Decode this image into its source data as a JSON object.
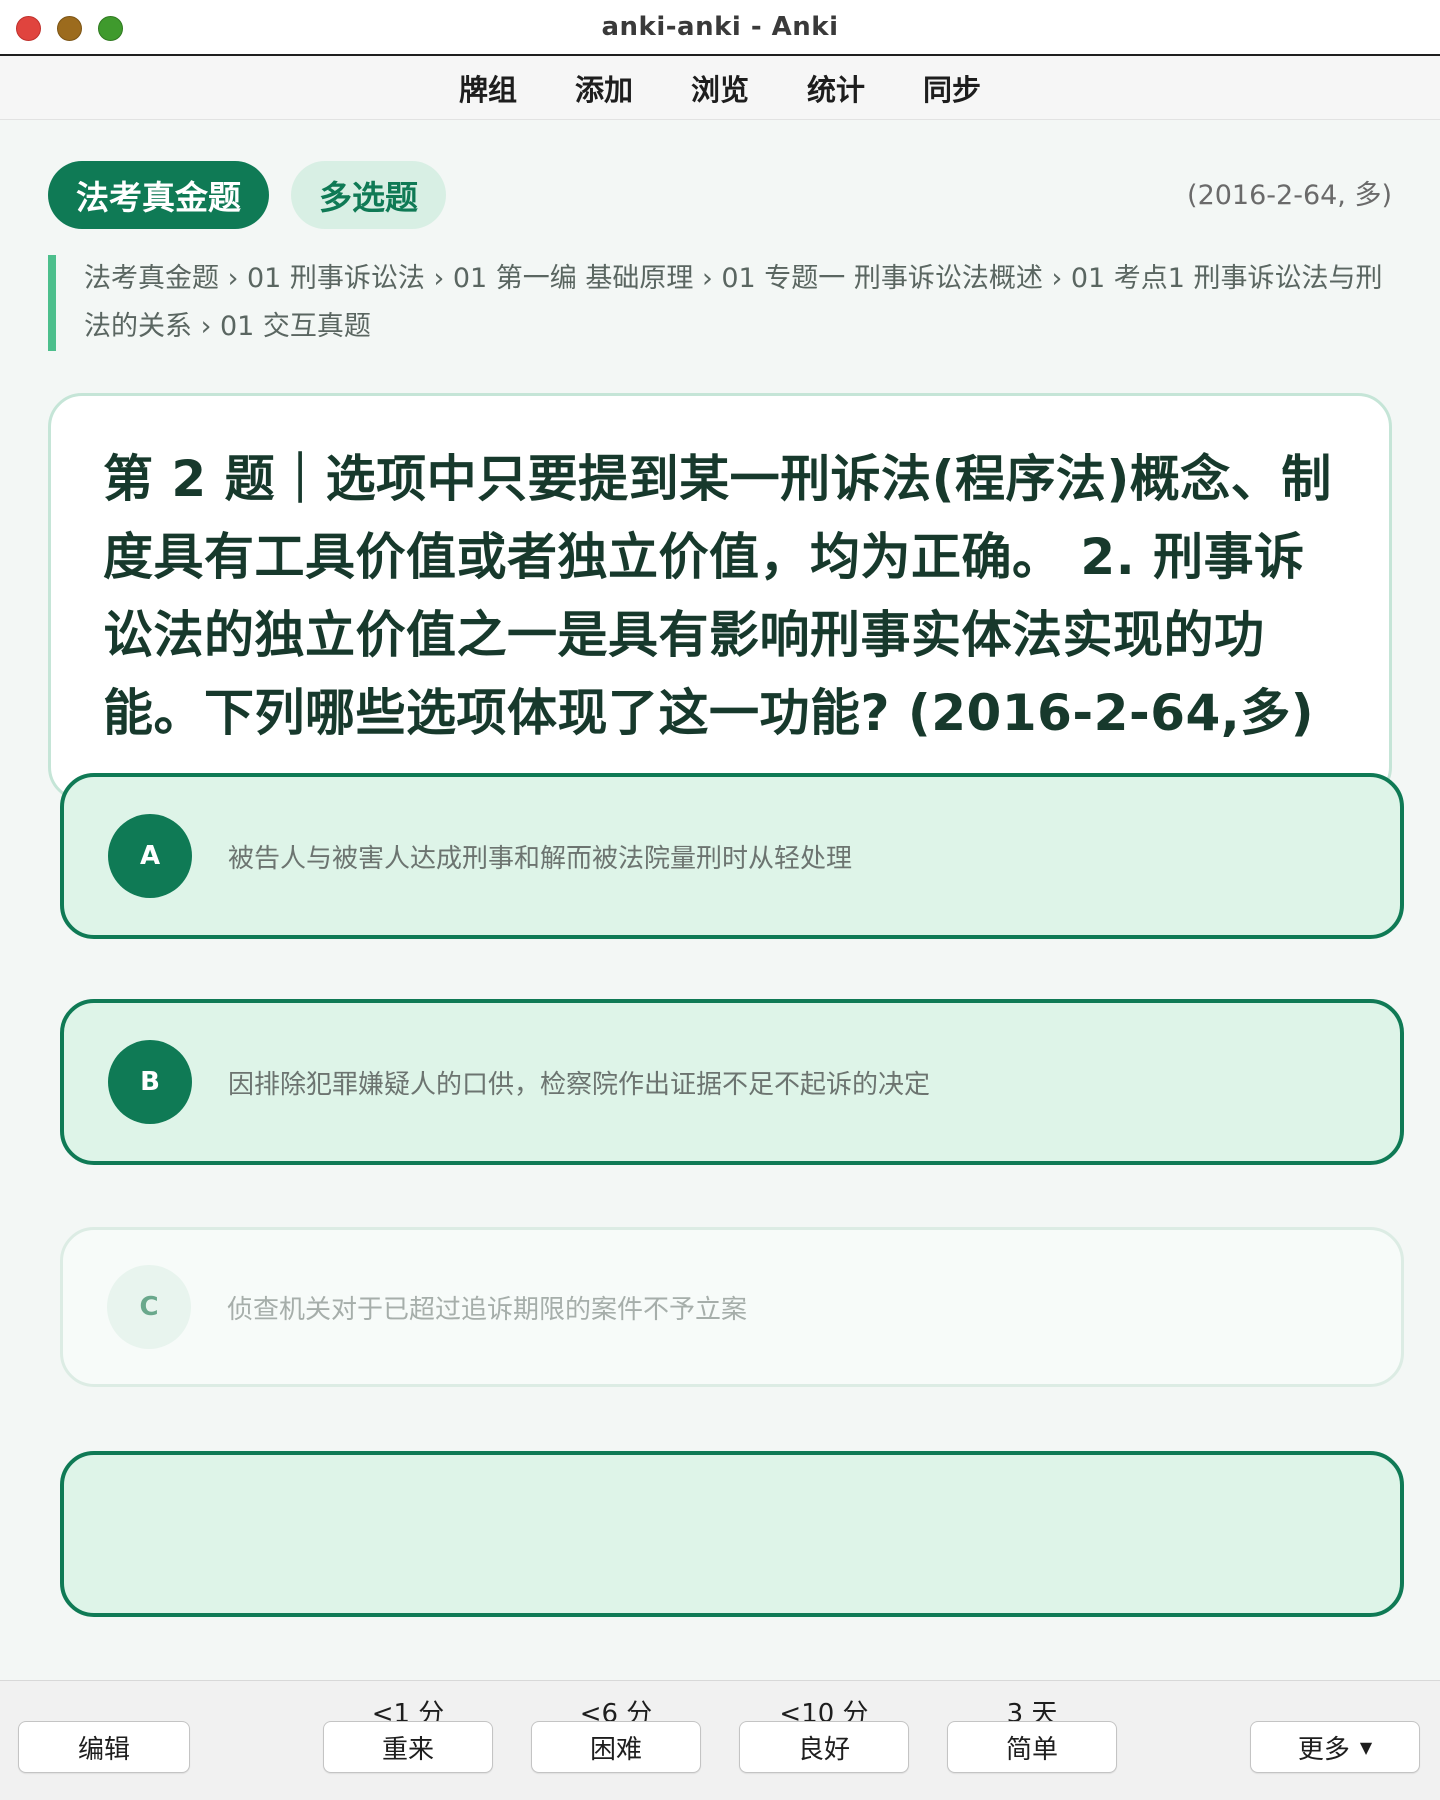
{
  "window": {
    "title": "anki-anki - Anki"
  },
  "menu": {
    "items": [
      "牌组",
      "添加",
      "浏览",
      "统计",
      "同步"
    ]
  },
  "card": {
    "tags": [
      "法考真金题",
      "多选题"
    ],
    "ref_code": "(2016-2-64, 多)",
    "breadcrumb": "法考真金题 › 01 刑事诉讼法 › 01 第一编 基础原理 › 01 专题一 刑事诉讼法概述 › 01 考点1 刑事诉讼法与刑法的关系 › 01 交互真题",
    "question": "第 2 题｜选项中只要提到某一刑诉法(程序法)概念、制度具有工具价值或者独立价值，均为正确。 2. 刑事诉讼法的独立价值之一是具有影响刑事实体法实现的功能。下列哪些选项体现了这一功能? (2016-2-64,多)",
    "options": [
      {
        "letter": "A",
        "text": "被告人与被害人达成刑事和解而被法院量刑时从轻处理",
        "selected": true
      },
      {
        "letter": "B",
        "text": "因排除犯罪嫌疑人的口供，检察院作出证据不足不起诉的决定",
        "selected": true
      },
      {
        "letter": "C",
        "text": "侦查机关对于已超过追诉期限的案件不予立案",
        "selected": false
      }
    ]
  },
  "bottom": {
    "edit_label": "编辑",
    "more_label": "更多",
    "ease": [
      {
        "interval": "<1 分",
        "label": "重来"
      },
      {
        "interval": "<6 分",
        "label": "困难"
      },
      {
        "interval": "<10 分",
        "label": "良好"
      },
      {
        "interval": "3 天",
        "label": "简单"
      }
    ]
  },
  "colors": {
    "accent": "#0f7a55",
    "selected_bg": "#def4e8",
    "tag_secondary_bg": "#d8efe4",
    "breadcrumb_bar": "#4cbf8c"
  }
}
